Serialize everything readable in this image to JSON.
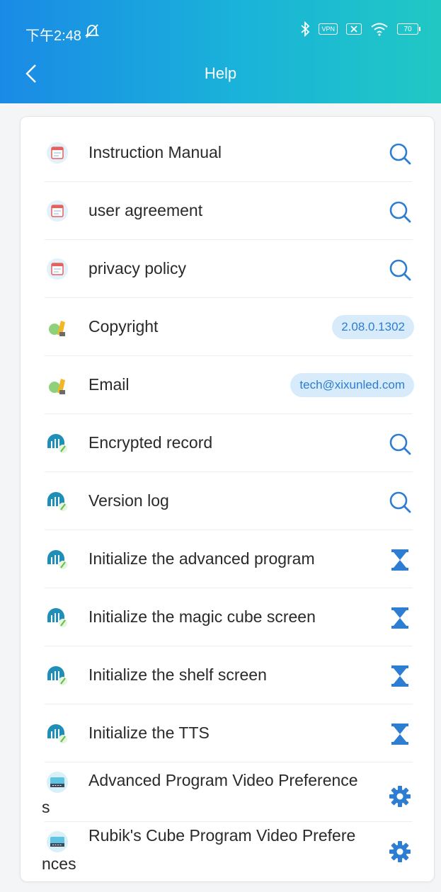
{
  "status_bar": {
    "time": "下午2:48",
    "icons": [
      "mute-icon",
      "bluetooth-icon",
      "vpn-icon",
      "sim-off-icon",
      "wifi-icon",
      "battery-icon"
    ],
    "vpn_label": "VPN",
    "battery_level": "70"
  },
  "header": {
    "title": "Help",
    "back_icon": "chevron-left-icon"
  },
  "colors": {
    "header_start": "#1a8ae6",
    "header_end": "#20c8c4",
    "accent": "#2d7dd2",
    "pill_bg": "#d7ebfb"
  },
  "rows": [
    {
      "label": "Instruction Manual",
      "icon": "document-icon",
      "action": "search-icon"
    },
    {
      "label": "user agreement",
      "icon": "document-icon",
      "action": "search-icon"
    },
    {
      "label": "privacy policy",
      "icon": "document-icon",
      "action": "search-icon"
    },
    {
      "label": "Copyright",
      "icon": "tools-icon",
      "action": "pill",
      "value": "2.08.0.1302"
    },
    {
      "label": "Email",
      "icon": "tools-icon",
      "action": "pill",
      "value": "tech@xixunled.com"
    },
    {
      "label": "Encrypted record",
      "icon": "led-icon",
      "action": "search-icon"
    },
    {
      "label": "Version log",
      "icon": "led-icon",
      "action": "search-icon"
    },
    {
      "label": "Initialize the advanced program",
      "icon": "led-icon",
      "action": "hourglass-icon"
    },
    {
      "label": "Initialize the magic cube screen",
      "icon": "led-icon",
      "action": "hourglass-icon"
    },
    {
      "label": "Initialize the shelf screen",
      "icon": "led-icon",
      "action": "hourglass-icon"
    },
    {
      "label": "Initialize the TTS",
      "icon": "led-icon",
      "action": "hourglass-icon"
    },
    {
      "label_line1": "Advanced Program Video Preference",
      "label_line2": "s",
      "icon": "video-icon",
      "action": "gear-icon"
    },
    {
      "label_line1": "Rubik's Cube Program Video Prefere",
      "label_line2": "nces",
      "icon": "video-icon",
      "action": "gear-icon"
    }
  ]
}
